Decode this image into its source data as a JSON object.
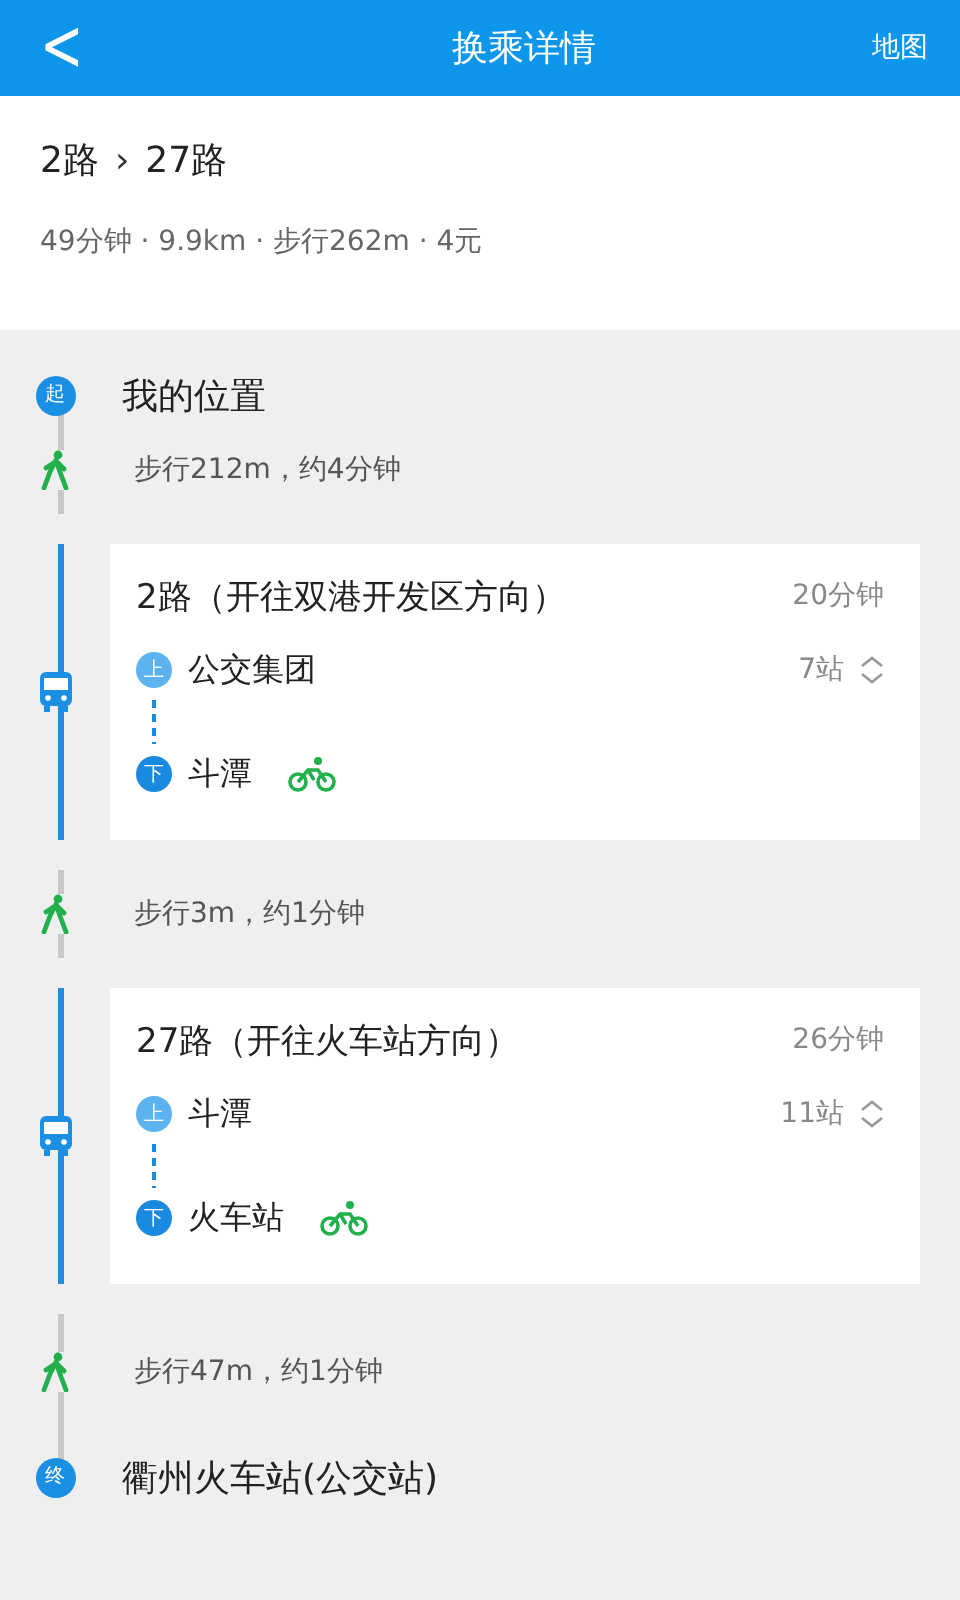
{
  "header": {
    "back": "<",
    "title": "换乘详情",
    "action": "地图"
  },
  "summary": {
    "lines": [
      "2路",
      "27路"
    ],
    "separator": "›",
    "meta": "49分钟 · 9.9km · 步行262m · 4元"
  },
  "steps": [
    {
      "kind": "start",
      "badge": "起",
      "text": "我的位置"
    },
    {
      "kind": "walk",
      "text": "步行212m，约4分钟"
    },
    {
      "kind": "bus",
      "title": "2路（开往双港开发区方向）",
      "duration": "20分钟",
      "board": {
        "badge": "上",
        "name": "公交集团"
      },
      "stops": "7站",
      "alight": {
        "badge": "下",
        "name": "斗潭",
        "bike": true
      }
    },
    {
      "kind": "walk",
      "text": "步行3m，约1分钟"
    },
    {
      "kind": "bus",
      "title": "27路（开往火车站方向）",
      "duration": "26分钟",
      "board": {
        "badge": "上",
        "name": "斗潭"
      },
      "stops": "11站",
      "alight": {
        "badge": "下",
        "name": "火车站",
        "bike": true
      }
    },
    {
      "kind": "walk",
      "text": "步行47m，约1分钟"
    },
    {
      "kind": "end",
      "badge": "终",
      "text": "衢州火车站(公交站)"
    }
  ]
}
